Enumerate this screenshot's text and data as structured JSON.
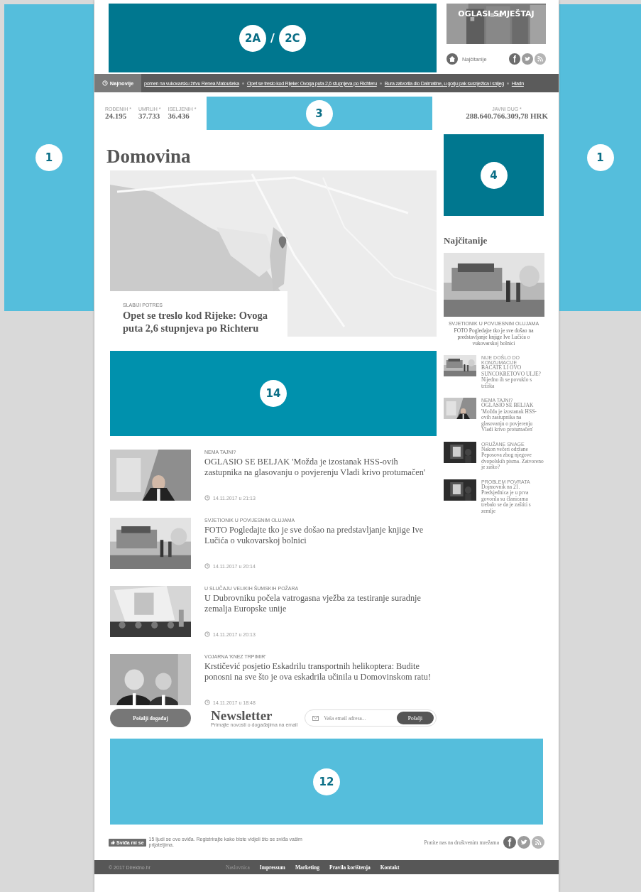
{
  "left_ad": {
    "label": "1"
  },
  "header": {
    "leaderboard_ad": {
      "labels": [
        "2A",
        "2C"
      ],
      "separator": "/"
    },
    "promo": {
      "kind": "picture",
      "title": "OGLASI SMJEŠTAJ"
    },
    "most_read_link": "Najčitanije",
    "social": [
      {
        "kind": "facebook"
      },
      {
        "kind": "twitter"
      },
      {
        "kind": "rss"
      }
    ]
  },
  "ticker": {
    "label": "Najnovije",
    "items": [
      "pomen na vukovarsku žrtvu Renea Matoušeka",
      "Opet se treslo kod Rijeke: Ovoga puta 2,6 stupnjeva po Richteru",
      "Bura zatvorila dio Dalmatine, u gorju pak susnježica i snijeg",
      "Hladn"
    ]
  },
  "stats": {
    "items": [
      {
        "label": "ROĐENIH *",
        "value": "24.195"
      },
      {
        "label": "UMRLIH *",
        "value": "37.733"
      },
      {
        "label": "ISELJENIH *",
        "value": "36.436"
      }
    ],
    "strip_ad": {
      "label": "3"
    },
    "debt": {
      "label": "JAVNI DUG *",
      "value": "288.640.766.309,78 HRK"
    }
  },
  "section_title": "Domovina",
  "featured": {
    "kind": "picture",
    "kicker": "SLABIJI POTRES",
    "title": "Opet se treslo kod Rijeke: Ovoga puta 2,6 stupnjeva po Richteru"
  },
  "in_content_ad": {
    "label": "14"
  },
  "articles": [
    {
      "kicker": "NEMA TAJNI?",
      "title": "OGLASIO SE BELJAK 'Možda je izostanak HSS-ovih zastupnika na glasovanju o povjerenju Vladi krivo protumačen'",
      "time": "14.11.2017 u 21:13"
    },
    {
      "kicker": "SVJETIONIK U POVIJESNIM OLUJAMA",
      "title": "FOTO Pogledajte tko je sve došao na predstavljanje knjige Ive Lučića o vukovarskoj bolnici",
      "time": "14.11.2017 u 20:14"
    },
    {
      "kicker": "U SLUČAJU VELIKIH ŠUMSKIH POŽARA",
      "title": "U Dubrovniku počela vatrogasna vježba za testiranje suradnje zemalja Europske unije",
      "time": "14.11.2017 u 20:13"
    },
    {
      "kicker": "VOJARNA 'KNEZ TRPIMIR'",
      "title": "Krstičević posjetio Eskadrilu transportnih helikoptera: Budite ponosni na sve što je ova eskadrila učinila u Domovinskom ratu!",
      "time": "14.11.2017 u 18:48"
    }
  ],
  "newsletter": {
    "event_button": "Pošalji događaj",
    "title": "Newsletter",
    "subtitle": "Primajte novosti o događajima na email",
    "placeholder": "Vaša email adresa...",
    "submit": "Pošalji"
  },
  "bottom_ad": {
    "label": "12"
  },
  "sidebar": {
    "ad": {
      "label": "4"
    },
    "heading": "Najčitanije",
    "top": {
      "kicker": "SVJETIONIK U POVIJESNIM OLUJAMA",
      "title": "FOTO Pogledajte tko je sve došao na predstavljanje knjige Ive Lučića o vukovarskoj bolnici"
    },
    "items": [
      {
        "kicker": "NIJE DOŠLO DO KONZUMACIJE",
        "title": "BACATE LI OVO SUNCOKRETOVO ULJE? Nijedno ih se povuklo s tržišta"
      },
      {
        "kicker": "NEMA TAJNI?",
        "title": "OGLASIO SE BELJAK 'Možda je izostanak HSS-ovih zastupnika na glasovanju o povjerenju Vladi krivo protumačen'"
      },
      {
        "kicker": "ORUŽANE SNAGE",
        "title": "Nakon večeri održane Peposova zbog njegove dvopolskih pisma. Zatvoreno je zašto?"
      },
      {
        "kicker": "PROBLEM POVRATA",
        "title": "Dojmovnik na 21. Predsjednica je u prva govorila su članicama trebalo se da je zaštiti s zemlje"
      }
    ]
  },
  "right_ad": {
    "label": "1"
  },
  "footer": {
    "like_button": "Sviđa mi se",
    "like_text": "15 ljudi se ovo sviđa. Registrirajte kako biste vidjeli što se sviđa vašim prijateljima.",
    "follow_text": "Pratite nas na društvenim mrežama",
    "social": [
      {
        "kind": "facebook"
      },
      {
        "kind": "twitter"
      },
      {
        "kind": "rss"
      }
    ],
    "copyright": "© 2017 Direktno.hr",
    "links": [
      {
        "label": "Naslovnica",
        "selected": true
      },
      {
        "label": "Impressum",
        "selected": false
      },
      {
        "label": "Marketing",
        "selected": false
      },
      {
        "label": "Pravila korištenja",
        "selected": false
      },
      {
        "label": "Kontakt",
        "selected": false
      }
    ]
  }
}
